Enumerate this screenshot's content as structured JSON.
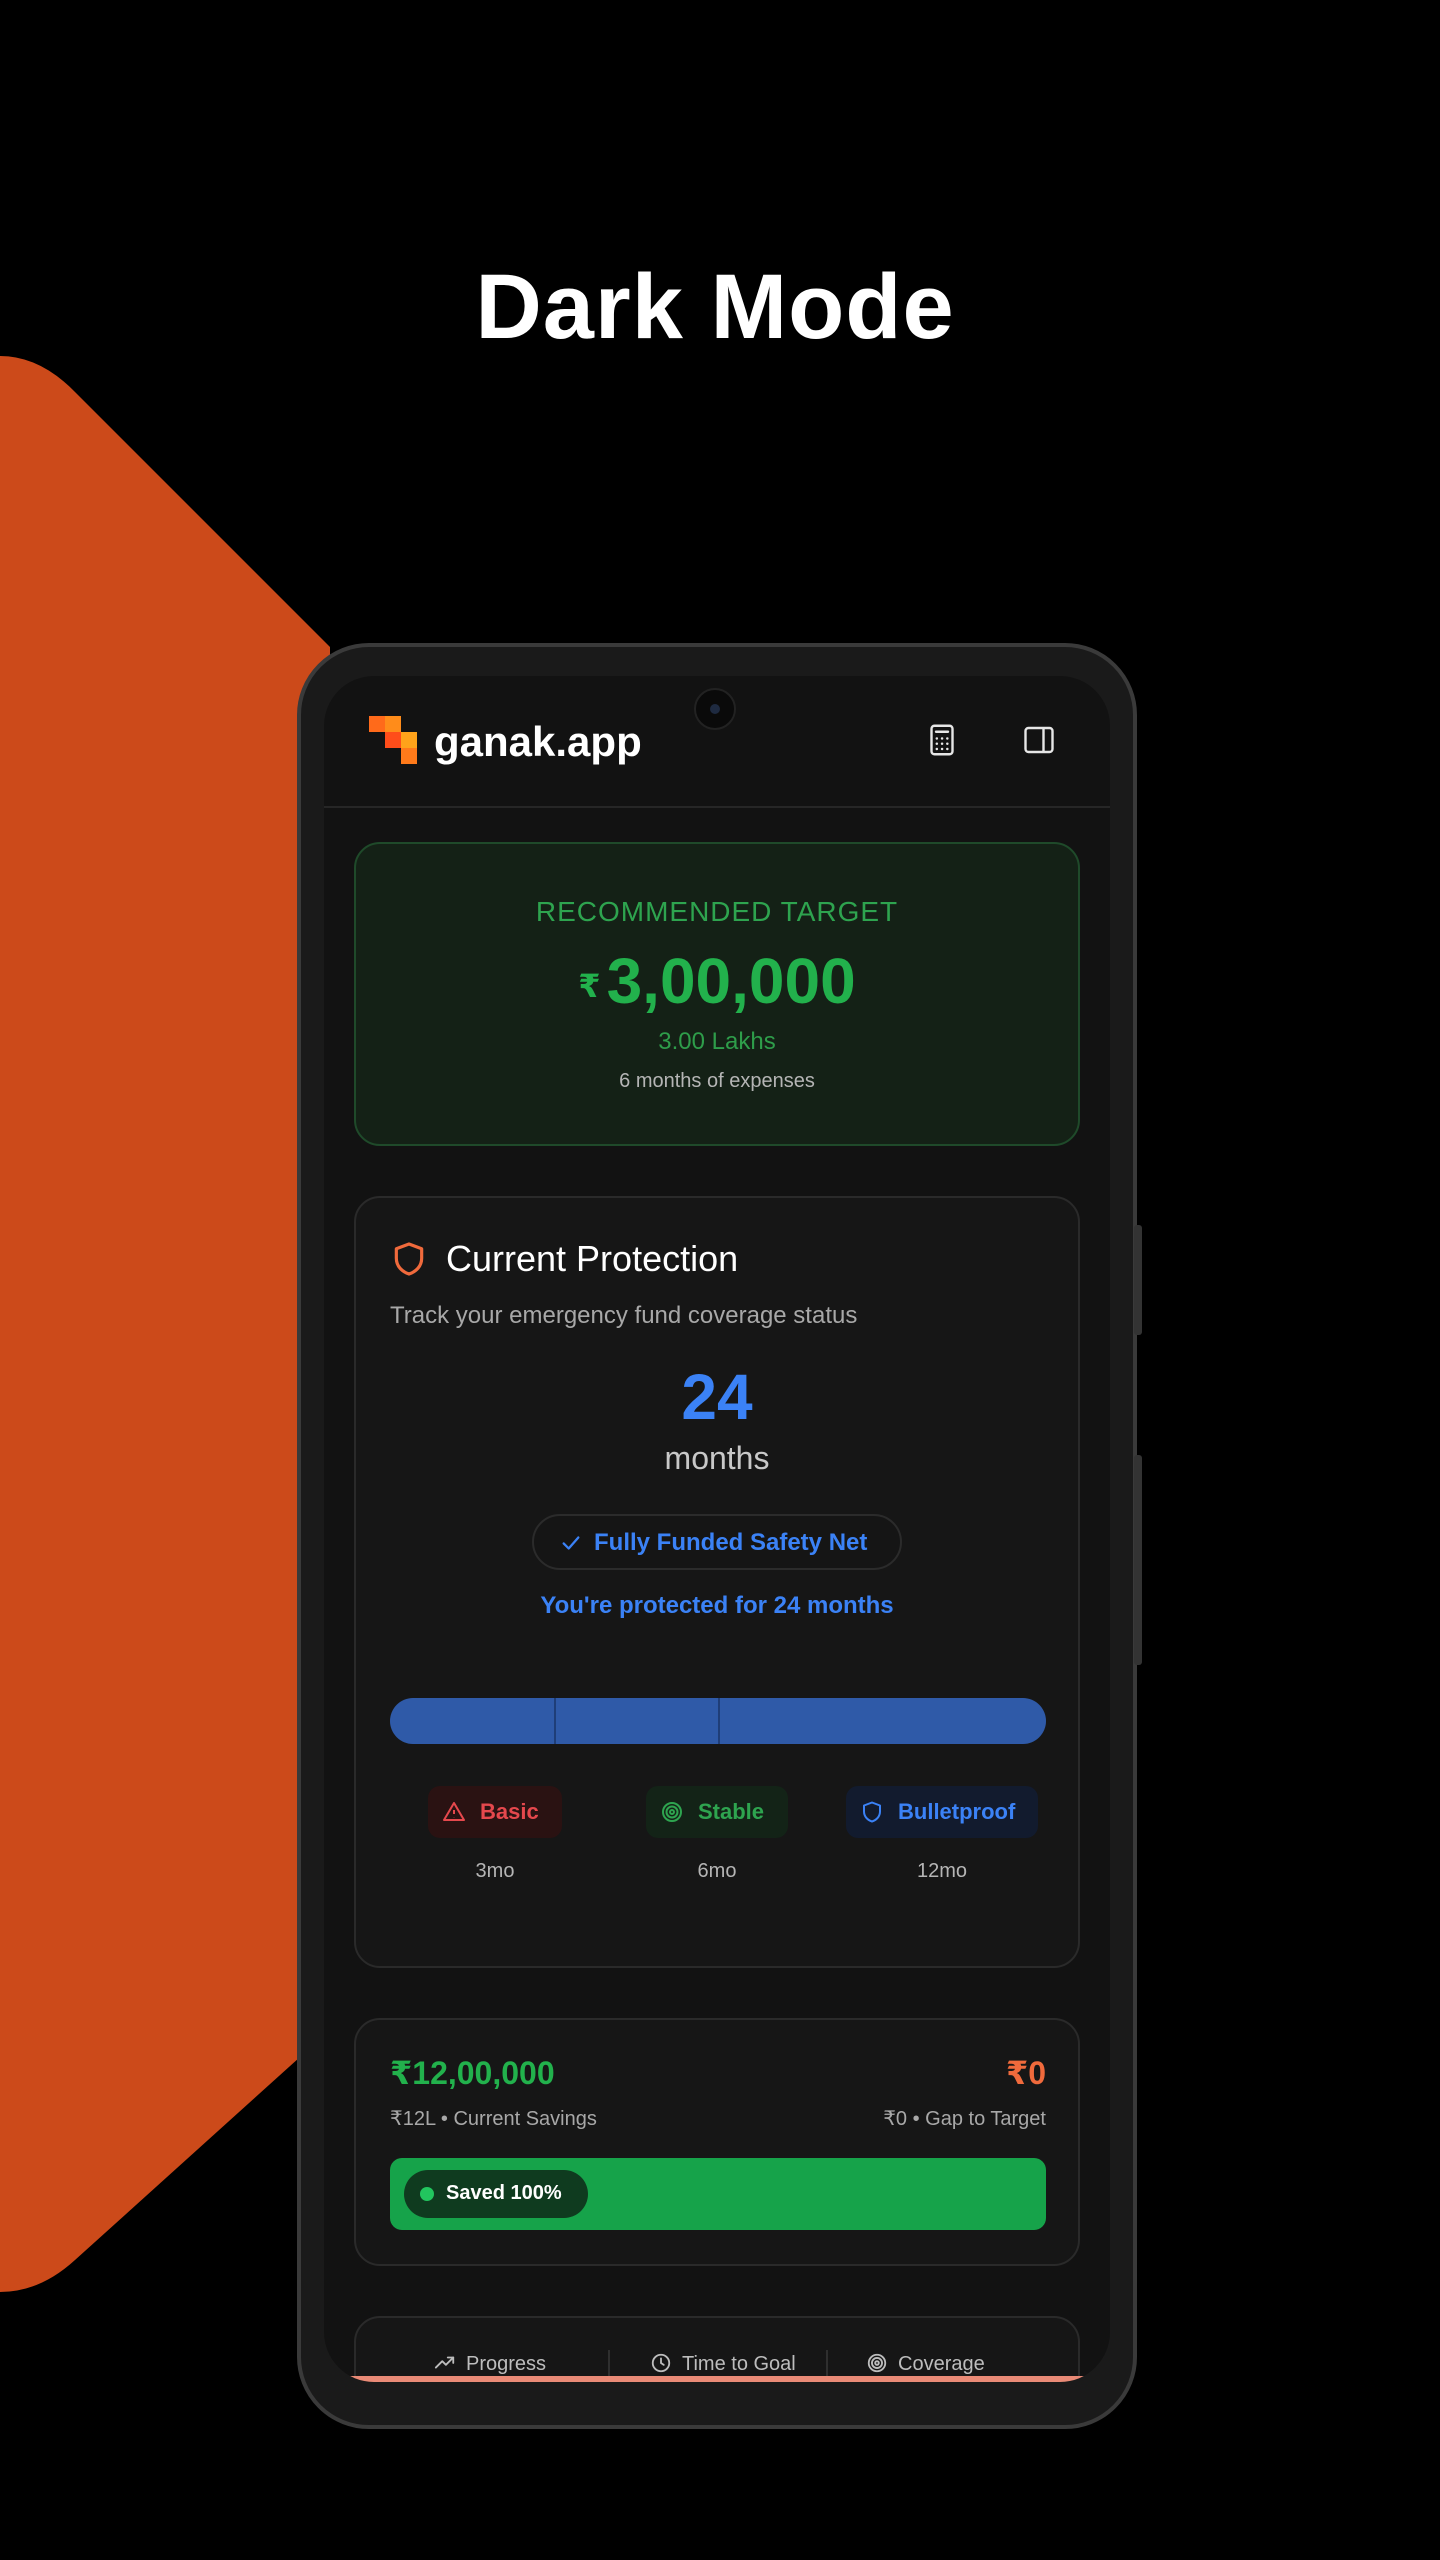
{
  "headline": "Dark Mode",
  "colors": {
    "accent_orange": "#CC4A1A",
    "green": "#22B14C",
    "blue": "#3B82F6",
    "red": "#E5484D"
  },
  "appbar": {
    "brand": "ganak.app",
    "icons": [
      "calculator-icon",
      "sidebar-toggle-icon"
    ]
  },
  "target": {
    "label": "RECOMMENDED TARGET",
    "currency": "₹",
    "amount": "3,00,000",
    "lakhs": "3.00 Lakhs",
    "note": "6 months of expenses"
  },
  "protection": {
    "title": "Current Protection",
    "subtitle": "Track your emergency fund coverage status",
    "months_value": "24",
    "months_label": "months",
    "status_pill": "Fully Funded Safety Net",
    "protected_text": "You're protected for 24 months",
    "coverage_fraction": 1.0,
    "tiers": [
      {
        "label": "Basic",
        "months": "3mo",
        "icon": "warning-icon"
      },
      {
        "label": "Stable",
        "months": "6mo",
        "icon": "target-icon"
      },
      {
        "label": "Bulletproof",
        "months": "12mo",
        "icon": "shield-icon"
      }
    ]
  },
  "savings": {
    "current_amount": "₹12,00,000",
    "current_label": "₹12L • Current Savings",
    "gap_amount": "₹0",
    "gap_label": "₹0 • Gap to Target",
    "saved_text": "Saved 100%",
    "saved_fraction": 1.0
  },
  "tabs": [
    {
      "label": "Progress",
      "icon": "trending-up-icon"
    },
    {
      "label": "Time to Goal",
      "icon": "clock-icon"
    },
    {
      "label": "Coverage",
      "icon": "target-icon"
    }
  ]
}
